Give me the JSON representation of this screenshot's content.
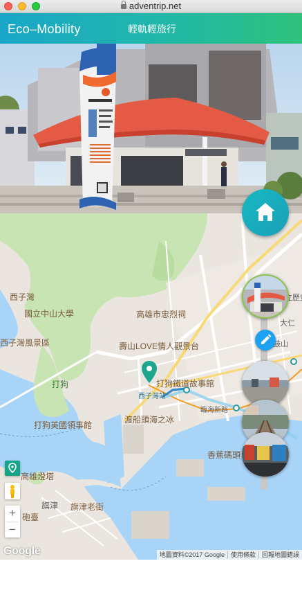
{
  "browser": {
    "url": "adventrip.net"
  },
  "header": {
    "brand": "Eco–Mobility",
    "subtitle": "輕軌輕旅行"
  },
  "photo": {
    "station_sign_top": "西子灣站"
  },
  "map": {
    "labels": {
      "xiziwan": "西子灣",
      "nsysu": "國立中山大學",
      "xiziwan_scenic": "西子灣風景區",
      "takao": "打狗",
      "martyrs_shrine": "高雄市忠烈祠",
      "shoushan_love": "壽山LOVE情人觀景台",
      "takao_railway": "打狗鐵道故事館",
      "british_consulate": "打狗英國領事館",
      "ferry_ice": "渡船頭海之冰",
      "kaohsiung_lighthouse": "高雄燈塔",
      "qijin": "旗津",
      "qijin_old_street": "旗津老街",
      "cijin_fort": "砲臺",
      "banana_pier": "香蕉碼頭",
      "gushan": "鼓山",
      "linhai_rd": "臨海新路",
      "daren": "大仁",
      "history_museum": "立歷史",
      "xiziwan_station": "西子灣站"
    },
    "zoom_in": "+",
    "zoom_out": "−",
    "google": "Google",
    "copyright": [
      "地圖資料©2017 Google",
      "使用條款",
      "回報地圖錯誤"
    ]
  },
  "colors": {
    "accent": "#1aa6c9",
    "active_ring": "#8bc34a",
    "edit": "#1da1f2",
    "water": "#a8d4f8",
    "park": "#c9e4b3"
  },
  "icons": {
    "home": "home-icon",
    "edit": "pencil-icon",
    "pegman": "pegman-icon",
    "marker": "map-marker-icon",
    "route_button": "route-icon"
  }
}
